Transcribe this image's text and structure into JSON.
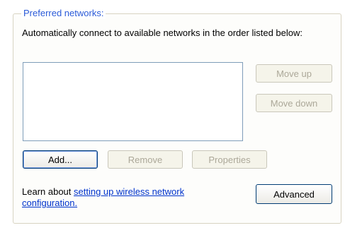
{
  "groupbox": {
    "label": "Preferred networks:"
  },
  "description": "Automatically connect to available networks in the order listed below:",
  "network_list": [],
  "buttons": {
    "move_up": "Move up",
    "move_down": "Move down",
    "add": "Add...",
    "remove": "Remove",
    "properties": "Properties",
    "advanced": "Advanced"
  },
  "learn": {
    "prefix": "Learn about ",
    "link": "setting up wireless network configuration."
  }
}
